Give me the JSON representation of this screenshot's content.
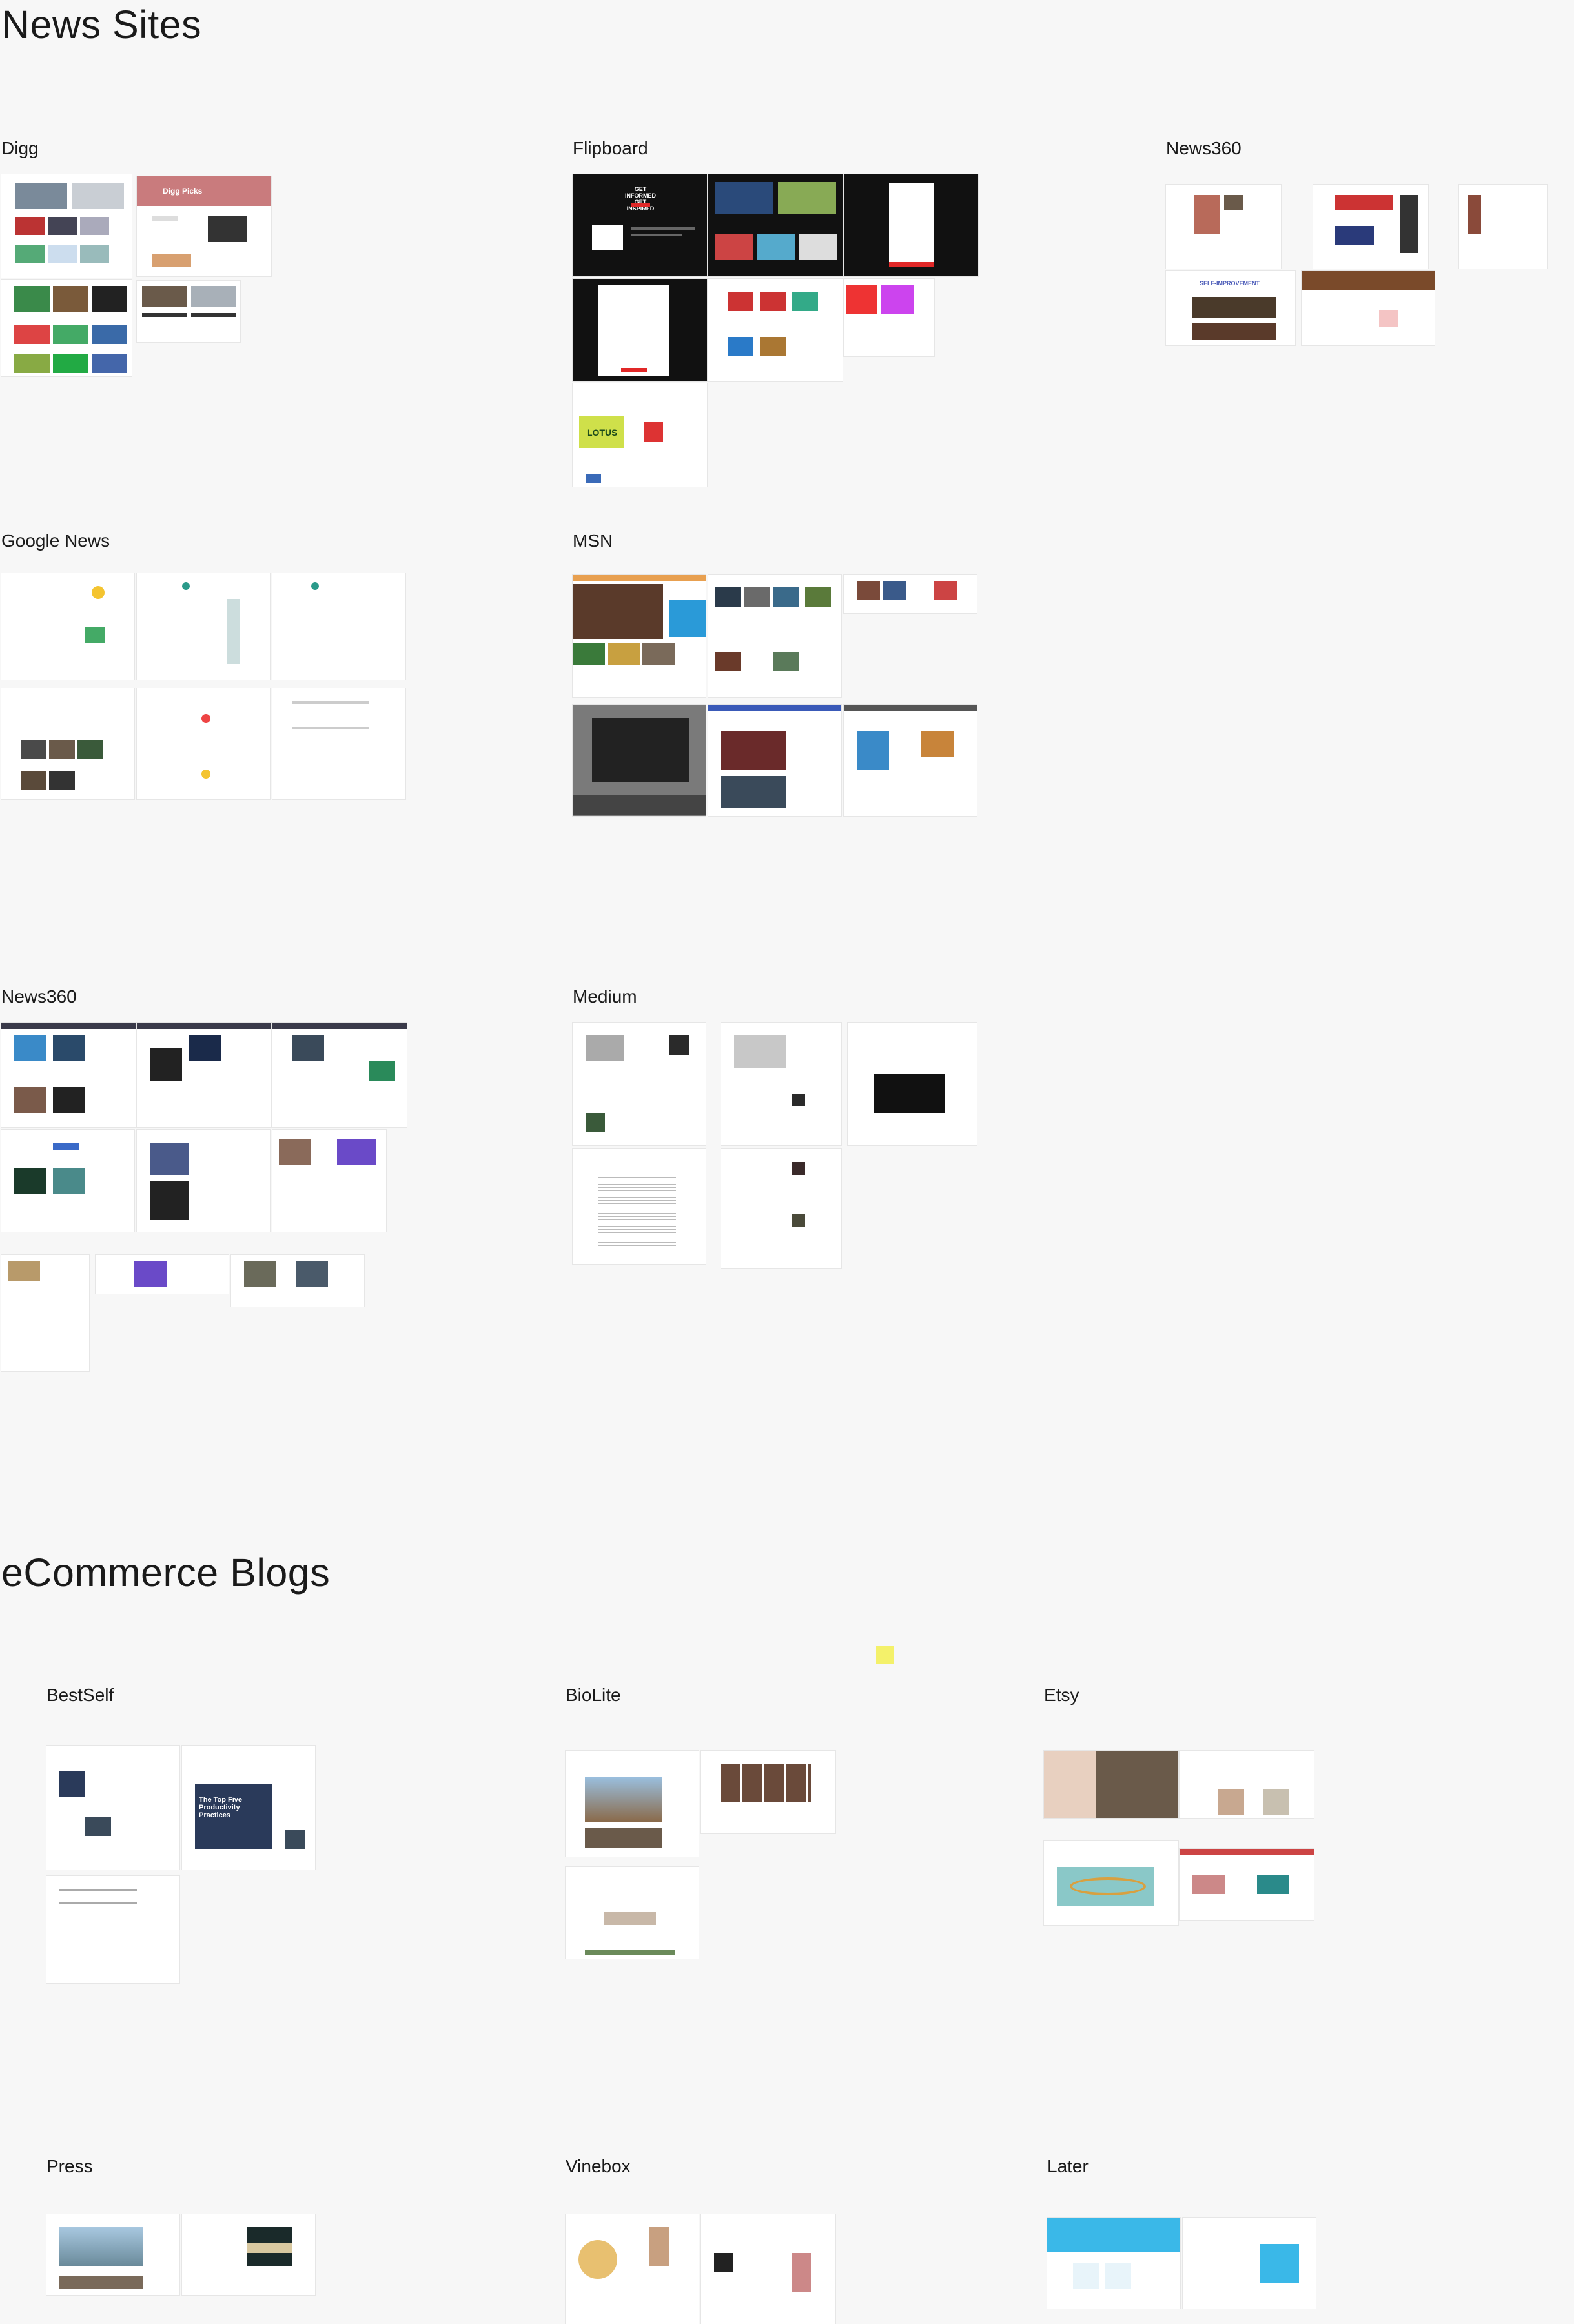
{
  "sections": [
    {
      "title": "News Sites",
      "boards": [
        {
          "name": "Digg"
        },
        {
          "name": "Flipboard"
        },
        {
          "name": "News360"
        },
        {
          "name": "Google News"
        },
        {
          "name": "MSN"
        },
        {
          "name": "News360"
        },
        {
          "name": "Medium"
        }
      ]
    },
    {
      "title": "eCommerce Blogs",
      "boards": [
        {
          "name": "BestSelf"
        },
        {
          "name": "BioLite"
        },
        {
          "name": "Etsy"
        },
        {
          "name": "Press"
        },
        {
          "name": "Vinebox"
        },
        {
          "name": "Later"
        }
      ]
    }
  ],
  "thumbnail_text": {
    "digg_picks": "Digg Picks",
    "flipboard_hero": "GET INFORMED GET INSPIRED",
    "lotus": "LOTUS",
    "self_improvement": "SELF-IMPROVEMENT",
    "bestself_hero": "The Top Five Productivity Practices"
  }
}
